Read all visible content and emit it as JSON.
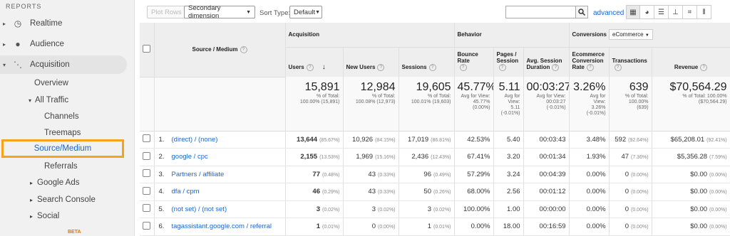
{
  "sidebar": {
    "section": "REPORTS",
    "items": {
      "realtime": "Realtime",
      "audience": "Audience",
      "acquisition": "Acquisition",
      "overview": "Overview",
      "all_traffic": "All Traffic",
      "channels": "Channels",
      "treemaps": "Treemaps",
      "source_medium": "Source/Medium",
      "referrals": "Referrals",
      "google_ads": "Google Ads",
      "search_console": "Search Console",
      "social": "Social"
    },
    "beta": "BETA"
  },
  "toolbar": {
    "plot_rows": "Plot Rows",
    "secondary_dimension": "Secondary dimension",
    "sort_type_label": "Sort Type:",
    "sort_type_value": "Default",
    "search_placeholder": "",
    "advanced": "advanced"
  },
  "table": {
    "dim_header": "Source / Medium",
    "groups": {
      "acquisition": "Acquisition",
      "behavior": "Behavior",
      "conversions": "Conversions",
      "conversion_type": "eCommerce"
    },
    "columns": {
      "users": "Users",
      "new_users": "New Users",
      "sessions": "Sessions",
      "bounce_rate": "Bounce Rate",
      "pages_session": "Pages / Session",
      "avg_session_duration": "Avg. Session Duration",
      "ecommerce_conversion_rate": "Ecommerce Conversion Rate",
      "transactions": "Transactions",
      "revenue": "Revenue"
    },
    "totals": {
      "users": {
        "value": "15,891",
        "line1": "% of Total:",
        "line2": "100.00% (15,891)",
        "line3": ""
      },
      "new_users": {
        "value": "12,984",
        "line1": "% of Total:",
        "line2": "100.08% (12,973)",
        "line3": ""
      },
      "sessions": {
        "value": "19,605",
        "line1": "% of Total:",
        "line2": "100.01% (19,603)",
        "line3": ""
      },
      "bounce_rate": {
        "value": "45.77%",
        "line1": "Avg for View:",
        "line2": "45.77%",
        "line3": "(0.00%)"
      },
      "pages_session": {
        "value": "5.11",
        "line1": "Avg for",
        "line2": "View:",
        "line3": "5.11",
        "line4": "(-0.01%)"
      },
      "avg_session_duration": {
        "value": "00:03:27",
        "line1": "Avg for View:",
        "line2": "00:03:27",
        "line3": "(-0.01%)"
      },
      "ecommerce_conversion_rate": {
        "value": "3.26%",
        "line1": "Avg for",
        "line2": "View:",
        "line3": "3.26%",
        "line4": "(-0.01%)"
      },
      "transactions": {
        "value": "639",
        "line1": "% of Total:",
        "line2": "100.00%",
        "line3": "(639)"
      },
      "revenue": {
        "value": "$70,564.29",
        "line1": "% of Total: 100.00%",
        "line2": "($70,564.29)",
        "line3": ""
      }
    },
    "rows": [
      {
        "index": "1.",
        "source": "(direct) / (none)",
        "users": "13,644",
        "users_pct": "(85.67%)",
        "new_users": "10,926",
        "new_users_pct": "(84.15%)",
        "sessions": "17,019",
        "sessions_pct": "(86.81%)",
        "bounce": "42.53%",
        "pages": "5.40",
        "duration": "00:03:43",
        "conv": "3.48%",
        "trans": "592",
        "trans_pct": "(92.64%)",
        "revenue": "$65,208.01",
        "revenue_pct": "(92.41%)"
      },
      {
        "index": "2.",
        "source": "google / cpc",
        "users": "2,155",
        "users_pct": "(13.53%)",
        "new_users": "1,969",
        "new_users_pct": "(15.16%)",
        "sessions": "2,436",
        "sessions_pct": "(12.43%)",
        "bounce": "67.41%",
        "pages": "3.20",
        "duration": "00:01:34",
        "conv": "1.93%",
        "trans": "47",
        "trans_pct": "(7.36%)",
        "revenue": "$5,356.28",
        "revenue_pct": "(7.59%)"
      },
      {
        "index": "3.",
        "source": "Partners / affiliate",
        "users": "77",
        "users_pct": "(0.48%)",
        "new_users": "43",
        "new_users_pct": "(0.33%)",
        "sessions": "96",
        "sessions_pct": "(0.49%)",
        "bounce": "57.29%",
        "pages": "3.24",
        "duration": "00:04:39",
        "conv": "0.00%",
        "trans": "0",
        "trans_pct": "(0.00%)",
        "revenue": "$0.00",
        "revenue_pct": "(0.00%)"
      },
      {
        "index": "4.",
        "source": "dfa / cpm",
        "users": "46",
        "users_pct": "(0.29%)",
        "new_users": "43",
        "new_users_pct": "(0.33%)",
        "sessions": "50",
        "sessions_pct": "(0.26%)",
        "bounce": "68.00%",
        "pages": "2.56",
        "duration": "00:01:12",
        "conv": "0.00%",
        "trans": "0",
        "trans_pct": "(0.00%)",
        "revenue": "$0.00",
        "revenue_pct": "(0.00%)"
      },
      {
        "index": "5.",
        "source": "(not set) / (not set)",
        "users": "3",
        "users_pct": "(0.02%)",
        "new_users": "3",
        "new_users_pct": "(0.02%)",
        "sessions": "3",
        "sessions_pct": "(0.02%)",
        "bounce": "100.00%",
        "pages": "1.00",
        "duration": "00:00:00",
        "conv": "0.00%",
        "trans": "0",
        "trans_pct": "(0.00%)",
        "revenue": "$0.00",
        "revenue_pct": "(0.00%)"
      },
      {
        "index": "6.",
        "source": "tagassistant.google.com / referral",
        "users": "1",
        "users_pct": "(0.01%)",
        "new_users": "0",
        "new_users_pct": "(0.00%)",
        "sessions": "1",
        "sessions_pct": "(0.01%)",
        "bounce": "0.00%",
        "pages": "18.00",
        "duration": "00:16:59",
        "conv": "0.00%",
        "trans": "0",
        "trans_pct": "(0.00%)",
        "revenue": "$0.00",
        "revenue_pct": "(0.00%)"
      }
    ]
  }
}
